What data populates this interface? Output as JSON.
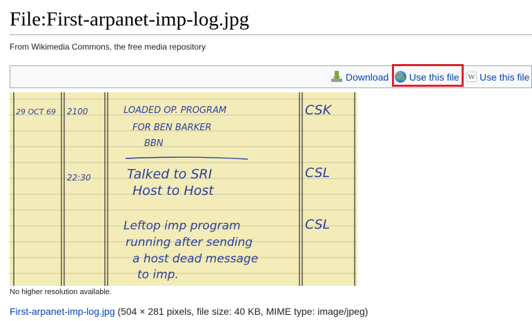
{
  "page": {
    "title": "File:First-arpanet-imp-log.jpg",
    "site_subtitle": "From Wikimedia Commons, the free media repository"
  },
  "toolbar": {
    "download_label": "Download",
    "use_file_label": "Use this file",
    "use_file_wiki_label": "Use this file",
    "highlighted_item": "use-this-file-button",
    "highlight_color": "#e0202a",
    "link_color": "#0645ad"
  },
  "image": {
    "log_entries": [
      {
        "date": "29 OCT 69",
        "time": "2100",
        "lines": [
          "LOADED OP. PROGRAM",
          "FOR BEN BARKER",
          "BBN"
        ],
        "initials": "CSK"
      },
      {
        "date": "",
        "time": "22:30",
        "lines": [
          "Talked to SRI",
          "Host to Host"
        ],
        "initials": "CSL"
      },
      {
        "date": "",
        "time": "",
        "lines": [
          "Leftop imp program",
          "running after sending",
          "a host dead message",
          "to imp."
        ],
        "initials": "CSL"
      }
    ],
    "paper_color": "#f3ecb8",
    "ink_color": "#2b3f9e"
  },
  "notes": {
    "no_higher_resolution": "No higher resolution available."
  },
  "file_info": {
    "link_text": "First-arpanet-imp-log.jpg",
    "details": "(504 × 281 pixels, file size: 40 KB, MIME type: image/jpeg)"
  }
}
